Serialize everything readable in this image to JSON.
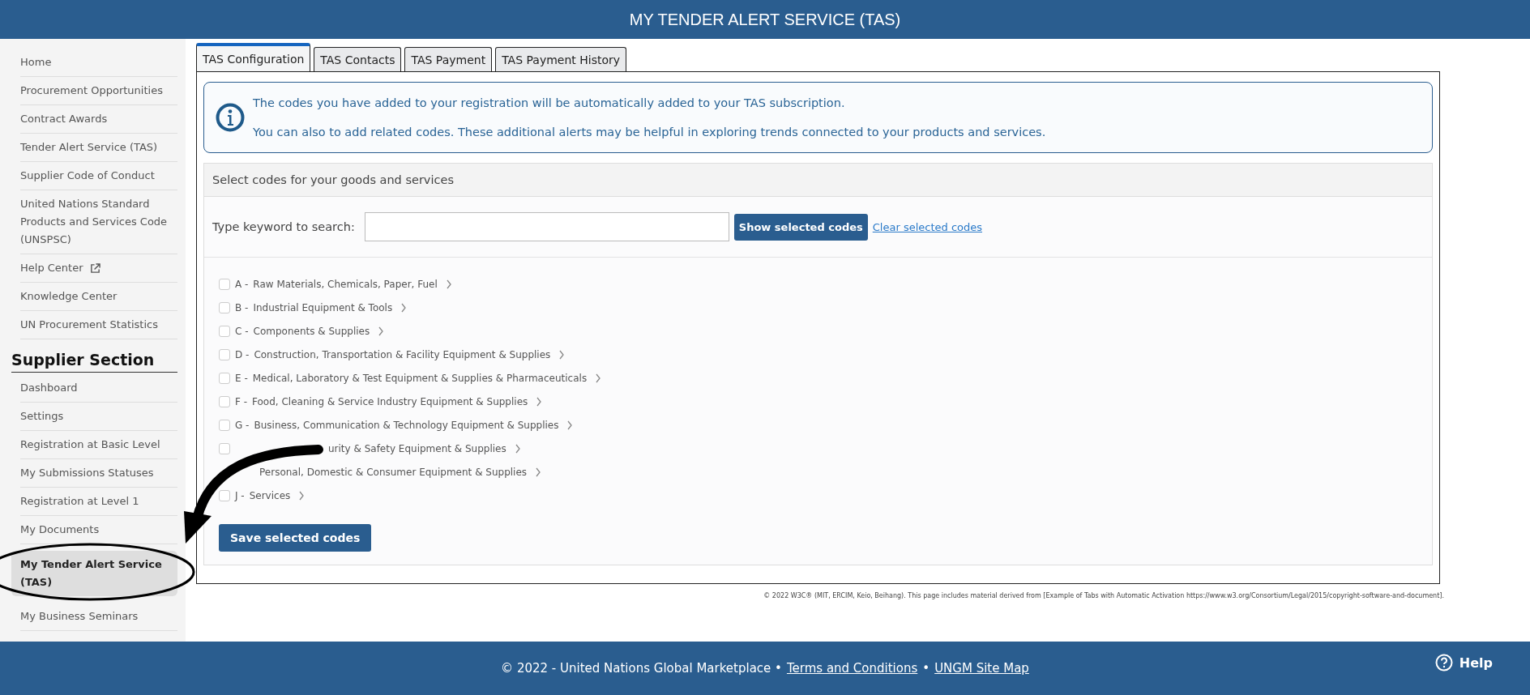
{
  "header": {
    "title": "MY TENDER ALERT SERVICE (TAS)"
  },
  "sidebar": {
    "items": [
      {
        "label": "Home",
        "selected": false
      },
      {
        "label": "Procurement Opportunities",
        "selected": false
      },
      {
        "label": "Contract Awards",
        "selected": false
      },
      {
        "label": "Tender Alert Service (TAS)",
        "selected": false
      },
      {
        "label": "Supplier Code of Conduct",
        "selected": false
      },
      {
        "label": "United Nations Standard Products and Services Code (UNSPSC)",
        "selected": false
      },
      {
        "label": "Help Center",
        "selected": false,
        "external": true
      },
      {
        "label": "Knowledge Center",
        "selected": false
      },
      {
        "label": "UN Procurement Statistics",
        "selected": false
      }
    ],
    "section_title": "Supplier Section",
    "section_items": [
      {
        "label": "Dashboard",
        "selected": false
      },
      {
        "label": "Settings",
        "selected": false
      },
      {
        "label": "Registration at Basic Level",
        "selected": false
      },
      {
        "label": "My Submissions Statuses",
        "selected": false
      },
      {
        "label": "Registration at Level 1",
        "selected": false
      },
      {
        "label": "My Documents",
        "selected": false
      },
      {
        "label": "My Tender Alert Service (TAS)",
        "selected": true
      },
      {
        "label": "My Business Seminars",
        "selected": false
      }
    ]
  },
  "tabs": [
    {
      "label": "TAS Configuration",
      "selected": true
    },
    {
      "label": "TAS Contacts",
      "selected": false
    },
    {
      "label": "TAS Payment",
      "selected": false
    },
    {
      "label": "TAS Payment History",
      "selected": false
    }
  ],
  "info": {
    "lines": [
      "The codes you have added to your registration will be automatically added to your TAS subscription.",
      "You can also to add related codes. These additional alerts may be helpful in exploring trends connected to your products and services."
    ]
  },
  "codes_panel": {
    "title": "Select codes for your goods and services",
    "search_label": "Type keyword to search:",
    "show_button": "Show selected codes",
    "clear_link": "Clear selected codes",
    "codes": [
      {
        "code": "A -",
        "label": "Raw Materials, Chemicals, Paper, Fuel",
        "checked": false
      },
      {
        "code": "B -",
        "label": "Industrial Equipment & Tools",
        "checked": false
      },
      {
        "code": "C -",
        "label": "Components & Supplies",
        "checked": false
      },
      {
        "code": "D -",
        "label": "Construction, Transportation & Facility Equipment & Supplies",
        "checked": false
      },
      {
        "code": "E -",
        "label": "Medical, Laboratory & Test Equipment & Supplies & Pharmaceuticals",
        "checked": false
      },
      {
        "code": "F -",
        "label": "Food, Cleaning & Service Industry Equipment & Supplies",
        "checked": false
      },
      {
        "code": "G -",
        "label": "Business, Communication & Technology Equipment & Supplies",
        "checked": false
      },
      {
        "label": "urity & Safety Equipment & Supplies",
        "checked": false
      },
      {
        "label": "Personal, Domestic & Consumer Equipment & Supplies"
      },
      {
        "code": "J -",
        "label": "Services",
        "checked": false
      }
    ],
    "save_button": "Save selected codes"
  },
  "copyright_note": "© 2022 W3C® (MIT, ERCIM, Keio, Beihang). This page includes material derived from [Example of Tabs with Automatic Activation https://www.w3.org/Consortium/Legal/2015/copyright-software-and-document].",
  "footer": {
    "copyright": "© 2022 - United Nations Global Marketplace •",
    "links": [
      "Terms and Conditions",
      "UNGM Site Map"
    ],
    "separator": "•",
    "help": "Help"
  }
}
